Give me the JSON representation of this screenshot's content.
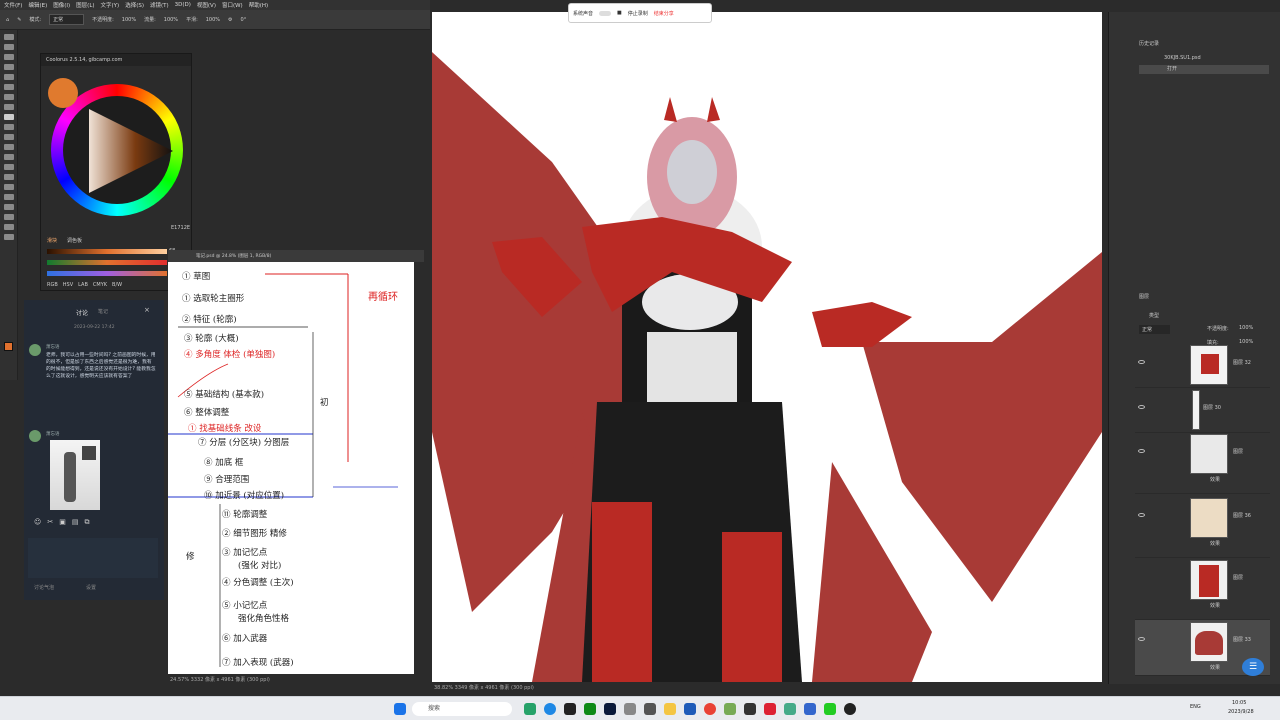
{
  "menubar": {
    "items": [
      "文件(F)",
      "编辑(E)",
      "图像(I)",
      "图层(L)",
      "文字(Y)",
      "选择(S)",
      "滤镜(T)",
      "3D(D)",
      "视图(V)",
      "窗口(W)",
      "帮助(H)"
    ]
  },
  "options": {
    "mode_label": "模式:",
    "mode_value": "正常",
    "opacity_label": "不透明度:",
    "opacity_value": "100%",
    "flow_label": "流量:",
    "flow_value": "100%",
    "smooth_label": "平滑:",
    "smooth_value": "100%",
    "angle_value": "0°"
  },
  "coolorus": {
    "title": "Coolorus 2.5.14, gibcamp.com",
    "hex": "E1712E",
    "tab1": "滑块",
    "tab2": "调色板",
    "slider1_value": "68",
    "slider2_value": "39",
    "slider3_value": "55",
    "modes": [
      "RGB",
      "HSV",
      "LAB",
      "CMYK",
      "B/W"
    ]
  },
  "chat": {
    "title": "讨论",
    "subtitle": "笔记",
    "date": "2023-09-22 17:42",
    "user1": "萧忘语",
    "message1": "老师，我可以占用一些时间吗? 之前画图的时候，用的很不，但是加了东西之后感觉还是很为难，我有的时候能想得到，还是说还没有开始设计? 能教我怎么了这就设计，感觉明天应该就有答案了",
    "user2": "萧忘语",
    "footer_text": "讨论气泡",
    "footer_settings": "设置"
  },
  "notes_window": {
    "title": "笔记.psd @ 24.8% (图层 1, RGB/8)",
    "status": "24.57%  3332 像素 x 4961 像素 (300 ppi)",
    "lines": [
      "① 草图",
      "① 选取轮主圈形",
      "② 特征 (轮廓)",
      "③ 轮廓  (大概)",
      "④ 多角度 体检 (单独图)",
      "⑤ 基础结构 (基本款)",
      "⑥ 整体调整",
      "① 找基础线条 改设",
      "⑦ 分层 (分区块) 分图层",
      "⑧ 加底 框",
      "⑨ 合理范围",
      "⑩ 加近景 (对应位置)",
      "⑪ 轮廓调整",
      "② 细节图形 精修",
      "③ 加记忆点",
      "(强化 对比)",
      "④ 分色调整 (主次)",
      "⑤ 小记忆点",
      "强化角色性格",
      "⑥ 加入武器",
      "⑦ 加入表现 (武器)"
    ],
    "annotations": {
      "right_title": "再循环",
      "stage1": "初",
      "stage2": "修"
    }
  },
  "canvas": {
    "status": "38.82%  3349 像素 x 4961 像素 (300 ppi)"
  },
  "recording": {
    "toggle_label": "系统声音",
    "stop_label": "停止录制",
    "end_label": "结束分享"
  },
  "right_panel": {
    "history_label": "历史记录",
    "doc_name": "30KJB.SU1.psd",
    "history_item": "打开",
    "layers_tab": "图层",
    "mode_value": "正常",
    "opacity_label": "不透明度:",
    "opacity_value": "100%",
    "fill_label": "填充:",
    "fill_value": "100%",
    "search_label": "类型",
    "layers": [
      {
        "name": "图层 32",
        "sub": ""
      },
      {
        "name": "图层 30",
        "sub": ""
      },
      {
        "name": "图层",
        "sub": "效果"
      },
      {
        "name": "图层 36",
        "sub": "效果"
      },
      {
        "name": "图层",
        "sub": "效果"
      },
      {
        "name": "图层 33",
        "sub": "效果"
      }
    ]
  },
  "taskbar": {
    "search_placeholder": "搜索",
    "lang": "ENG",
    "time": "10:05",
    "date": "2023/9/28"
  },
  "colors": {
    "accent": "#e1712e",
    "wing": "#a83a36",
    "shirt": "#1a1a1a"
  }
}
